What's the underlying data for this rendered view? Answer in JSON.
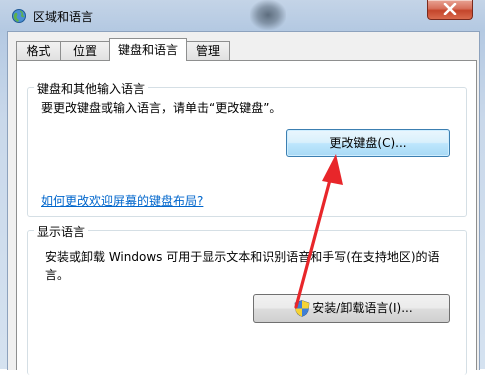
{
  "window": {
    "title": "区域和语言"
  },
  "tabs": [
    {
      "label": "格式"
    },
    {
      "label": "位置"
    },
    {
      "label": "键盘和语言"
    },
    {
      "label": "管理"
    }
  ],
  "keyboard_group": {
    "title": "键盘和其他输入语言",
    "description": "要更改键盘或输入语言，请单击“更改键盘”。",
    "button_label": "更改键盘(C)...",
    "link": "如何更改欢迎屏幕的键盘布局?"
  },
  "display_group": {
    "title": "显示语言",
    "description_line1": "安装或卸载 Windows 可用于显示文本和识别语音和手写(在支持地区)的语",
    "description_line2": "言。",
    "button_label": "安装/卸载语言(I)..."
  },
  "colors": {
    "link": "#0066cc",
    "annotation_arrow": "#e8262a",
    "focused_button": "#a7d9f5"
  }
}
